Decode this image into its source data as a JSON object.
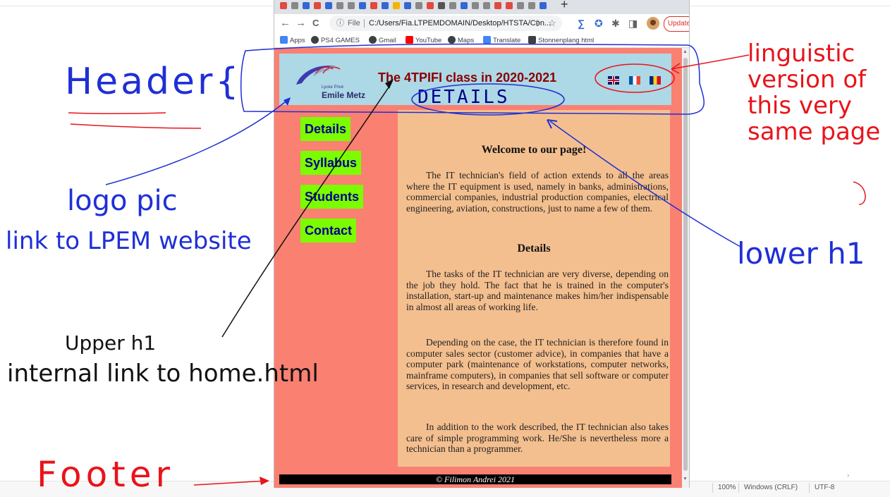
{
  "browser": {
    "tabs_new": "+",
    "toolbar": {
      "back": "←",
      "forward": "→",
      "reload": "C",
      "info": "ⓘ",
      "scheme": "File",
      "url": "C:/Users/Fia.LTPEMDOMAIN/Desktop/HTSTA/Con...",
      "share": "⇪",
      "star": "☆",
      "update_label": "Update"
    },
    "bookmarks": [
      {
        "label": "Apps",
        "color": "#4285f4"
      },
      {
        "label": "PS4 GAMES",
        "color": "#3c4043"
      },
      {
        "label": "Gmail",
        "color": "#3c4043"
      },
      {
        "label": "YouTube",
        "color": "#ff0000"
      },
      {
        "label": "Maps",
        "color": "#3c4043"
      },
      {
        "label": "Translate",
        "color": "#4285f4"
      },
      {
        "label": "Stonnenplang html",
        "color": "#3c4043"
      }
    ]
  },
  "page": {
    "logo_small": "Lycée Privé",
    "logo_name": "Emile Metz",
    "upper_h1": "The 4TPIFI class in 2020-2021",
    "lower_h1": "DETAILS",
    "flags": [
      "gb-flag",
      "fr-flag",
      "ro-flag"
    ],
    "nav": [
      "Details",
      "Syllabus",
      "Students",
      "Contact"
    ],
    "welcome_heading": "Welcome to our page!",
    "p1": "The IT technician's field of action extends to all the areas where the IT equipment is used, namely in banks, administrations, commercial companies, industrial production companies, electrical engineering, aviation, constructions, just to name a few of them.",
    "details_heading": "Details",
    "p2": "The tasks of the IT technician are very diverse, depending on the job they hold. The fact that he is trained in the computer's installation, start-up and maintenance makes him/her indispensable in almost all areas of working life.",
    "p3": "Depending on the case, the IT technician is therefore found in computer sales sector (customer advice), in companies that have a computer park (maintenance of workstations, computer networks, mainframe computers), in companies that sell software or computer services, in research and development, etc.",
    "p4": "In addition to the work described, the IT technician also takes care of simple programming work. He/She is nevertheless more a technician than a programmer.",
    "footer": "© Filimon Andrei 2021",
    "colors": {
      "page_bg": "#fa8072",
      "header_bg": "#add8e6",
      "content_bg": "#f4bf8f",
      "nav_bg": "#7cfc00",
      "footer_bg": "#000000"
    }
  },
  "editor_status": {
    "zoom": "100%",
    "eol": "Windows (CRLF)",
    "encoding": "UTF-8"
  },
  "annotations": {
    "header": "Header{",
    "footer": "Footer",
    "logo": "logo pic",
    "logo_link": "link to LPEM website",
    "upper_h1": "Upper h1",
    "internal_link": "internal link to home.html",
    "lower_h1": "lower h1",
    "linguistic": [
      "linguistic",
      "version of",
      "this very",
      "same page"
    ],
    "colors": {
      "blue_ink": "#1f2fd6",
      "red_ink": "#e8141b",
      "black_ink": "#111111"
    }
  }
}
